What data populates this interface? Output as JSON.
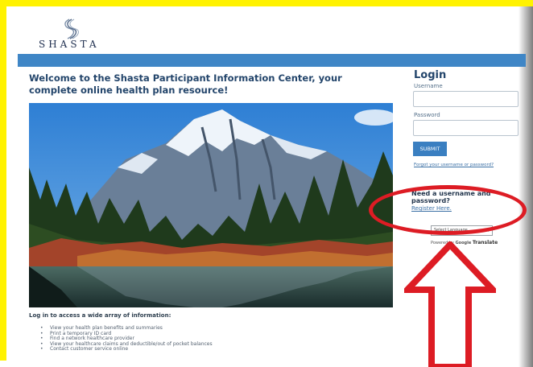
{
  "brand": {
    "name": "SHASTA"
  },
  "welcome": {
    "heading": "Welcome to the Shasta Participant Information Center, your complete online health plan resource!"
  },
  "info": {
    "heading": "Log in to access a wide array of information:",
    "items": [
      "View your health plan benefits and summaries",
      "Print a temporary ID card",
      "Find a network healthcare provider",
      "View your healthcare claims and deductible/out of pocket balances",
      "Contact customer service online"
    ]
  },
  "login": {
    "title": "Login",
    "username_label": "Username",
    "username_value": "",
    "password_label": "Password",
    "password_value": "",
    "submit_label": "SUBMIT",
    "forgot_link": "Forgot your username or password?"
  },
  "register": {
    "prompt": "Need a username and password?",
    "link": "Register Here."
  },
  "translate": {
    "select_value": "Select Language",
    "powered_prefix": "Powered by",
    "google": "Google",
    "translate_word": "Translate"
  },
  "annotation": {
    "highlight_color": "#dd1c24",
    "frame_color": "#fff200"
  },
  "colors": {
    "band": "#3f86c6",
    "heading": "#23456b",
    "button": "#3a7fc1",
    "link": "#3a6fa5"
  }
}
